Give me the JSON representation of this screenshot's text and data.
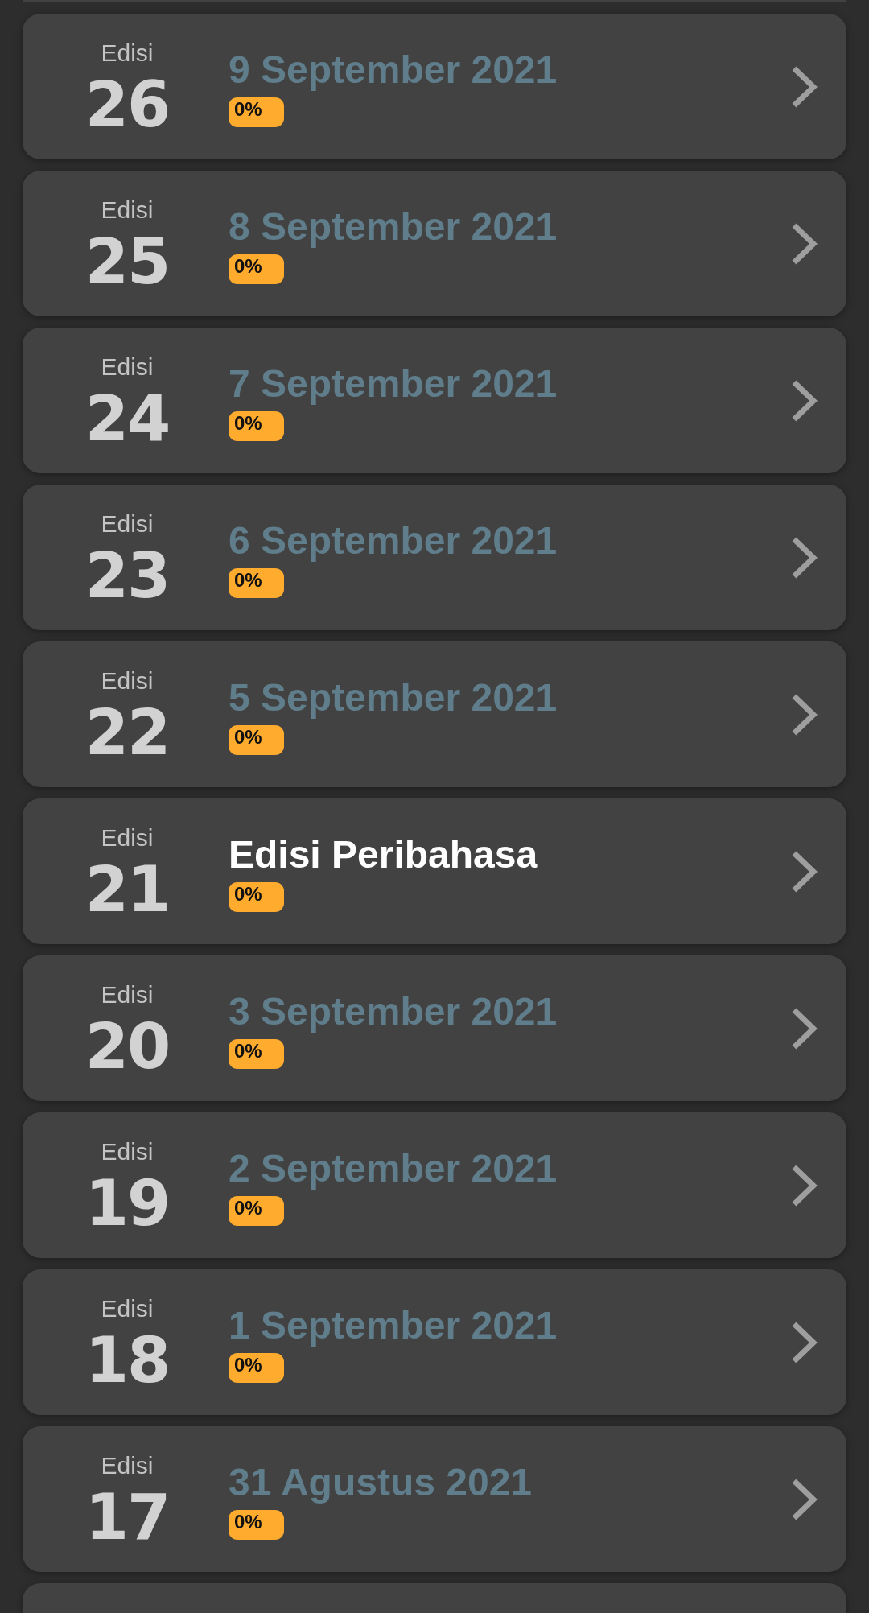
{
  "editions": [
    {
      "label": "Edisi",
      "number": "26",
      "title": "9 September 2021",
      "kind": "date",
      "progress": "0%"
    },
    {
      "label": "Edisi",
      "number": "25",
      "title": "8 September 2021",
      "kind": "date",
      "progress": "0%"
    },
    {
      "label": "Edisi",
      "number": "24",
      "title": "7 September 2021",
      "kind": "date",
      "progress": "0%"
    },
    {
      "label": "Edisi",
      "number": "23",
      "title": "6 September 2021",
      "kind": "date",
      "progress": "0%"
    },
    {
      "label": "Edisi",
      "number": "22",
      "title": "5 September 2021",
      "kind": "date",
      "progress": "0%"
    },
    {
      "label": "Edisi",
      "number": "21",
      "title": "Edisi Peribahasa",
      "kind": "special",
      "progress": "0%"
    },
    {
      "label": "Edisi",
      "number": "20",
      "title": "3 September 2021",
      "kind": "date",
      "progress": "0%"
    },
    {
      "label": "Edisi",
      "number": "19",
      "title": "2 September 2021",
      "kind": "date",
      "progress": "0%"
    },
    {
      "label": "Edisi",
      "number": "18",
      "title": "1 September 2021",
      "kind": "date",
      "progress": "0%"
    },
    {
      "label": "Edisi",
      "number": "17",
      "title": "31 Agustus 2021",
      "kind": "date",
      "progress": "0%"
    }
  ]
}
